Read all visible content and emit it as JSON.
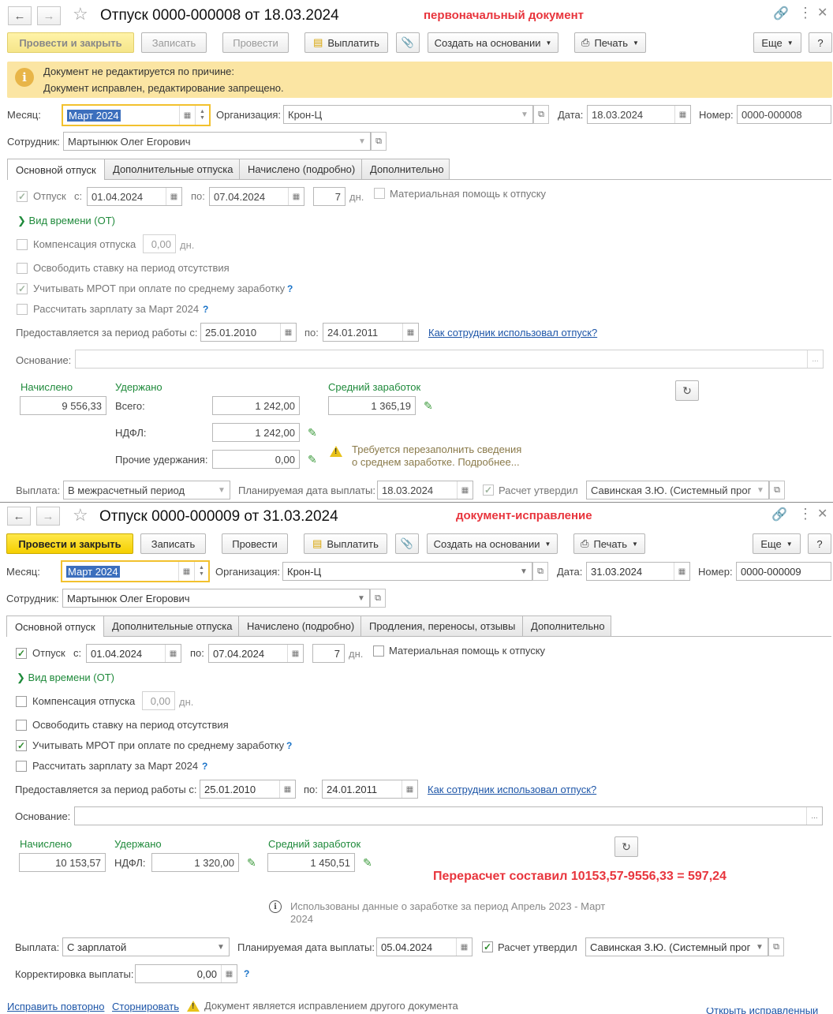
{
  "doc1": {
    "title": "Отпуск 0000-000008 от 18.03.2024",
    "caption": "первоначальный документ",
    "toolbar": {
      "post_close": "Провести и закрыть",
      "write": "Записать",
      "post": "Провести",
      "pay": "Выплатить",
      "create_based": "Создать на основании",
      "print": "Печать",
      "more": "Еще",
      "help": "?"
    },
    "banner": {
      "line1": "Документ не редактируется по причине:",
      "line2": "Документ исправлен, редактирование запрещено."
    },
    "header": {
      "month_label": "Месяц:",
      "month_value": "Март 2024",
      "org_label": "Организация:",
      "org_value": "Крон-Ц",
      "date_label": "Дата:",
      "date_value": "18.03.2024",
      "number_label": "Номер:",
      "number_value": "0000-000008",
      "employee_label": "Сотрудник:",
      "employee_value": "Мартынюк Олег Егорович"
    },
    "tabs": [
      "Основной отпуск",
      "Дополнительные отпуска",
      "Начислено (подробно)",
      "Дополнительно"
    ],
    "vacation": {
      "label": "Отпуск",
      "from_label": "с:",
      "from": "01.04.2024",
      "to_label": "по:",
      "to": "07.04.2024",
      "days": "7",
      "days_unit": "дн.",
      "material_aid": "Материальная помощь к отпуску",
      "time_type": "Вид времени (ОТ)",
      "compensation": "Компенсация отпуска",
      "compensation_days": "0,00",
      "compensation_unit": "дн.",
      "release_rate": "Освободить ставку на период отсутствия",
      "mrot": "Учитывать МРОТ при оплате по среднему заработку",
      "calc_salary": "Рассчитать зарплату за Март 2024",
      "period_label": "Предоставляется за период работы с:",
      "period_from": "25.01.2010",
      "period_to_label": "по:",
      "period_to": "24.01.2011",
      "usage_link": "Как сотрудник использовал отпуск?",
      "basis_label": "Основание:",
      "basis_value": ""
    },
    "totals": {
      "accrued_label": "Начислено",
      "accrued": "9 556,33",
      "withheld_label": "Удержано",
      "total_label": "Всего:",
      "total": "1 242,00",
      "ndfl_label": "НДФЛ:",
      "ndfl": "1 242,00",
      "other_label": "Прочие удержания:",
      "other": "0,00",
      "avg_label": "Средний заработок",
      "avg": "1 365,19",
      "warning_line1": "Требуется перезаполнить сведения",
      "warning_line2": "о среднем заработке. Подробнее..."
    },
    "payment": {
      "label": "Выплата:",
      "value": "В межрасчетный период",
      "planned_label": "Планируемая дата выплаты:",
      "planned": "18.03.2024",
      "approved_label": "Расчет утвердил",
      "approved_by": "Савинская З.Ю. (Системный прог"
    }
  },
  "doc2": {
    "title": "Отпуск 0000-000009 от 31.03.2024",
    "caption": "документ-исправление",
    "toolbar": {
      "post_close": "Провести и закрыть",
      "write": "Записать",
      "post": "Провести",
      "pay": "Выплатить",
      "create_based": "Создать на основании",
      "print": "Печать",
      "more": "Еще",
      "help": "?"
    },
    "header": {
      "month_label": "Месяц:",
      "month_value": "Март 2024",
      "org_label": "Организация:",
      "org_value": "Крон-Ц",
      "date_label": "Дата:",
      "date_value": "31.03.2024",
      "number_label": "Номер:",
      "number_value": "0000-000009",
      "employee_label": "Сотрудник:",
      "employee_value": "Мартынюк Олег Егорович"
    },
    "tabs": [
      "Основной отпуск",
      "Дополнительные отпуска",
      "Начислено (подробно)",
      "Продления, переносы, отзывы",
      "Дополнительно"
    ],
    "vacation": {
      "label": "Отпуск",
      "from_label": "с:",
      "from": "01.04.2024",
      "to_label": "по:",
      "to": "07.04.2024",
      "days": "7",
      "days_unit": "дн.",
      "material_aid": "Материальная помощь к отпуску",
      "time_type": "Вид времени (ОТ)",
      "compensation": "Компенсация отпуска",
      "compensation_days": "0,00",
      "compensation_unit": "дн.",
      "release_rate": "Освободить ставку на период отсутствия",
      "mrot": "Учитывать МРОТ при оплате по среднему заработку",
      "calc_salary": "Рассчитать зарплату за Март 2024",
      "period_label": "Предоставляется за период работы с:",
      "period_from": "25.01.2010",
      "period_to_label": "по:",
      "period_to": "24.01.2011",
      "usage_link": "Как сотрудник использовал отпуск?",
      "basis_label": "Основание:",
      "basis_value": ""
    },
    "totals": {
      "accrued_label": "Начислено",
      "accrued": "10 153,57",
      "withheld_label": "Удержано",
      "ndfl_label": "НДФЛ:",
      "ndfl": "1 320,00",
      "avg_label": "Средний заработок",
      "avg": "1 450,51",
      "recalc_note": "Перерасчет составил 10153,57-9556,33 = 597,24",
      "info_line1": "Использованы данные о заработке за период Апрель 2023 - Март",
      "info_line2": "2024"
    },
    "payment": {
      "label": "Выплата:",
      "value": "С зарплатой",
      "planned_label": "Планируемая дата выплаты:",
      "planned": "05.04.2024",
      "approved_label": "Расчет утвердил",
      "approved_by": "Савинская З.Ю. (Системный прог",
      "correction_label": "Корректировка выплаты:",
      "correction": "0,00"
    },
    "footer": {
      "fix_again": "Исправить повторно",
      "reverse": "Сторнировать",
      "notice": "Документ является исправлением другого документа",
      "open_corrected": "Открыть исправленный"
    }
  },
  "colors": {
    "accent_yellow": "#f5cf00",
    "banner_bg": "#fbe5a3",
    "caption_red": "#e8353d",
    "green_label": "#1f8a3b",
    "link_blue": "#1e56a8"
  }
}
